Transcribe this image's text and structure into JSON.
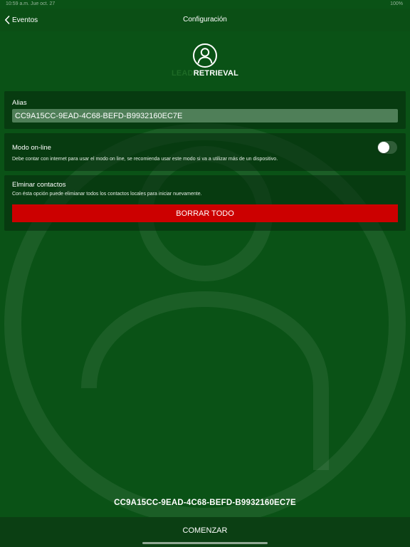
{
  "status_bar": {
    "time": "10:59 a.m.   Jue oct. 27",
    "battery": "100%"
  },
  "nav": {
    "back_label": "Eventos",
    "title": "Configuración"
  },
  "logo": {
    "lead": "LEAD",
    "retrieval": "RETRIEVAL",
    "icon": "person-circle-icon"
  },
  "alias": {
    "label": "Alias",
    "value": "CC9A15CC-9EAD-4C68-BEFD-B9932160EC7E"
  },
  "online_mode": {
    "label": "Modo on-line",
    "description": "Debe contar con internet para usar el modo on line, se recomienda usar este modo si va a utilizar más de un dispositivo.",
    "enabled": false
  },
  "delete_contacts": {
    "label": "Elminar contactos",
    "description": "Con ésta opción puede elimianar todos los contactos locales para iniciar nuevamente.",
    "button_label": "BORRAR TODO",
    "button_color": "#cc0000"
  },
  "footer": {
    "device_id": "CC9A15CC-9EAD-4C68-BEFD-B9932160EC7E",
    "start_label": "COMENZAR"
  },
  "colors": {
    "background": "#0a5216",
    "accent_red": "#cc0000"
  }
}
